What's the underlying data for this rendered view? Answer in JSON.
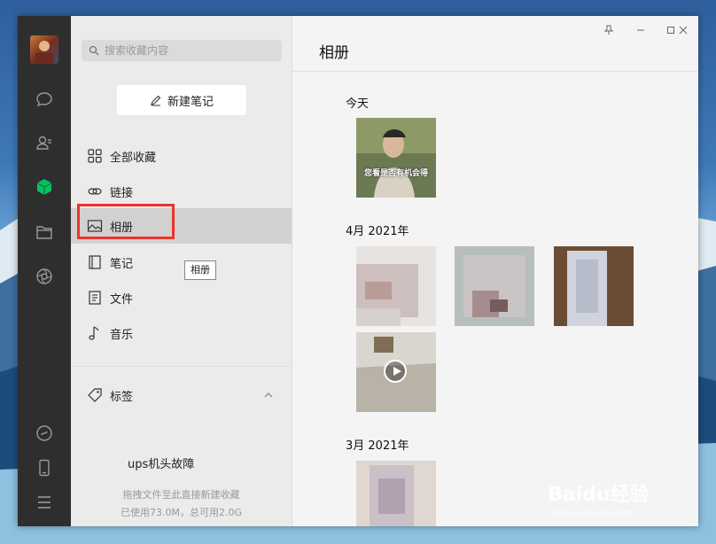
{
  "rail": {
    "icons": [
      "chat-icon",
      "contacts-icon",
      "favorites-icon",
      "folder-icon",
      "moments-icon",
      "miniprogram-icon",
      "phone-icon",
      "menu-icon"
    ]
  },
  "nav": {
    "search_placeholder": "搜索收藏内容",
    "new_note_label": "新建笔记",
    "items": [
      {
        "label": "全部收藏",
        "icon": "grid-icon"
      },
      {
        "label": "链接",
        "icon": "link-icon"
      },
      {
        "label": "相册",
        "icon": "image-icon",
        "active": true
      },
      {
        "label": "笔记",
        "icon": "notebook-icon"
      },
      {
        "label": "文件",
        "icon": "file-icon"
      },
      {
        "label": "音乐",
        "icon": "music-icon"
      }
    ],
    "tooltip": "相册",
    "tags_label": "标签",
    "tag_item": "ups机头故障",
    "drag_hint": "拖拽文件至此直接新建收藏",
    "storage_hint": "已使用73.0M，总可用2.0G"
  },
  "main": {
    "title": "相册",
    "sections": [
      {
        "label": "今天",
        "thumb_caption": "您看是否有机会得"
      },
      {
        "label": "4月 2021年"
      },
      {
        "label": "3月 2021年"
      }
    ]
  },
  "watermark": {
    "brand": "Baidu经验",
    "url": "jingyan.baidu.com"
  },
  "colors": {
    "rail": "#2e2e2e",
    "accent_green": "#07c160",
    "highlight_red": "#e8352f"
  }
}
